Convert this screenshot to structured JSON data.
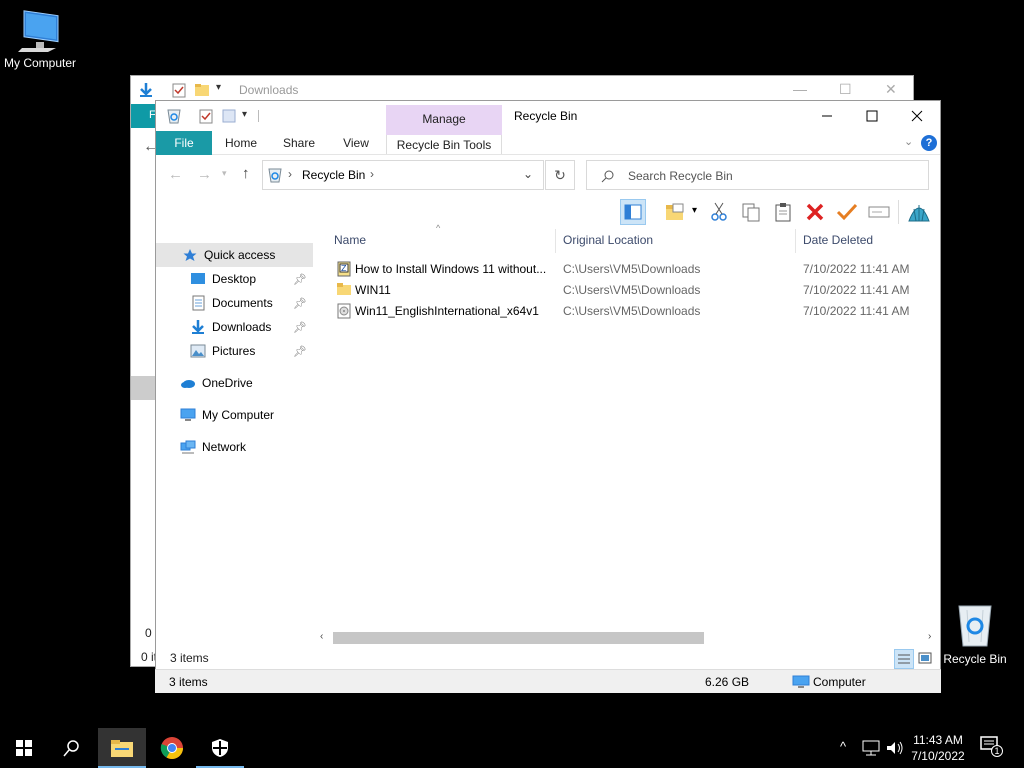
{
  "desktop": {
    "my_computer_label": "My Computer",
    "recycle_bin_label": "Recycle Bin"
  },
  "back_window": {
    "title": "Downloads",
    "partial_tab": "F",
    "partial_status_1": "0 i",
    "partial_status_2": "0 ite"
  },
  "window": {
    "title": "Recycle Bin",
    "ribbon": {
      "tabs": [
        "File",
        "Home",
        "Share",
        "View"
      ],
      "manage_label": "Manage",
      "tools_label": "Recycle Bin Tools"
    },
    "address": {
      "path": [
        "Recycle Bin"
      ],
      "search_placeholder": "Search Recycle Bin"
    },
    "nav": {
      "items": [
        {
          "label": "Quick access",
          "icon": "star-icon",
          "pinned": false,
          "selected": true
        },
        {
          "label": "Desktop",
          "icon": "desktop-folder-icon",
          "pinned": true
        },
        {
          "label": "Documents",
          "icon": "documents-folder-icon",
          "pinned": true
        },
        {
          "label": "Downloads",
          "icon": "downloads-folder-icon",
          "pinned": true
        },
        {
          "label": "Pictures",
          "icon": "pictures-folder-icon",
          "pinned": true
        },
        {
          "label": "OneDrive",
          "icon": "cloud-icon"
        },
        {
          "label": "My Computer",
          "icon": "computer-icon"
        },
        {
          "label": "Network",
          "icon": "network-icon"
        }
      ]
    },
    "list": {
      "columns": [
        "Name",
        "Original Location",
        "Date Deleted"
      ],
      "rows": [
        {
          "name": "How to Install Windows 11 without...",
          "location": "C:\\Users\\VM5\\Downloads",
          "date": "7/10/2022 11:41 AM",
          "icon": "zip-file-icon"
        },
        {
          "name": "WIN11",
          "location": "C:\\Users\\VM5\\Downloads",
          "date": "7/10/2022 11:41 AM",
          "icon": "folder-icon"
        },
        {
          "name": "Win11_EnglishInternational_x64v1",
          "location": "C:\\Users\\VM5\\Downloads",
          "date": "7/10/2022 11:41 AM",
          "icon": "disc-image-icon"
        }
      ]
    },
    "item_count": "3 items"
  },
  "status_bar": {
    "items": "3 items",
    "size": "6.26 GB",
    "location": "Computer"
  },
  "taskbar": {
    "time": "11:43 AM",
    "date": "7/10/2022",
    "notification_count": "1"
  },
  "colors": {
    "accent_teal": "#1a9aa6",
    "manage_purple": "#e8d5f4",
    "taskbar": "#000000"
  }
}
